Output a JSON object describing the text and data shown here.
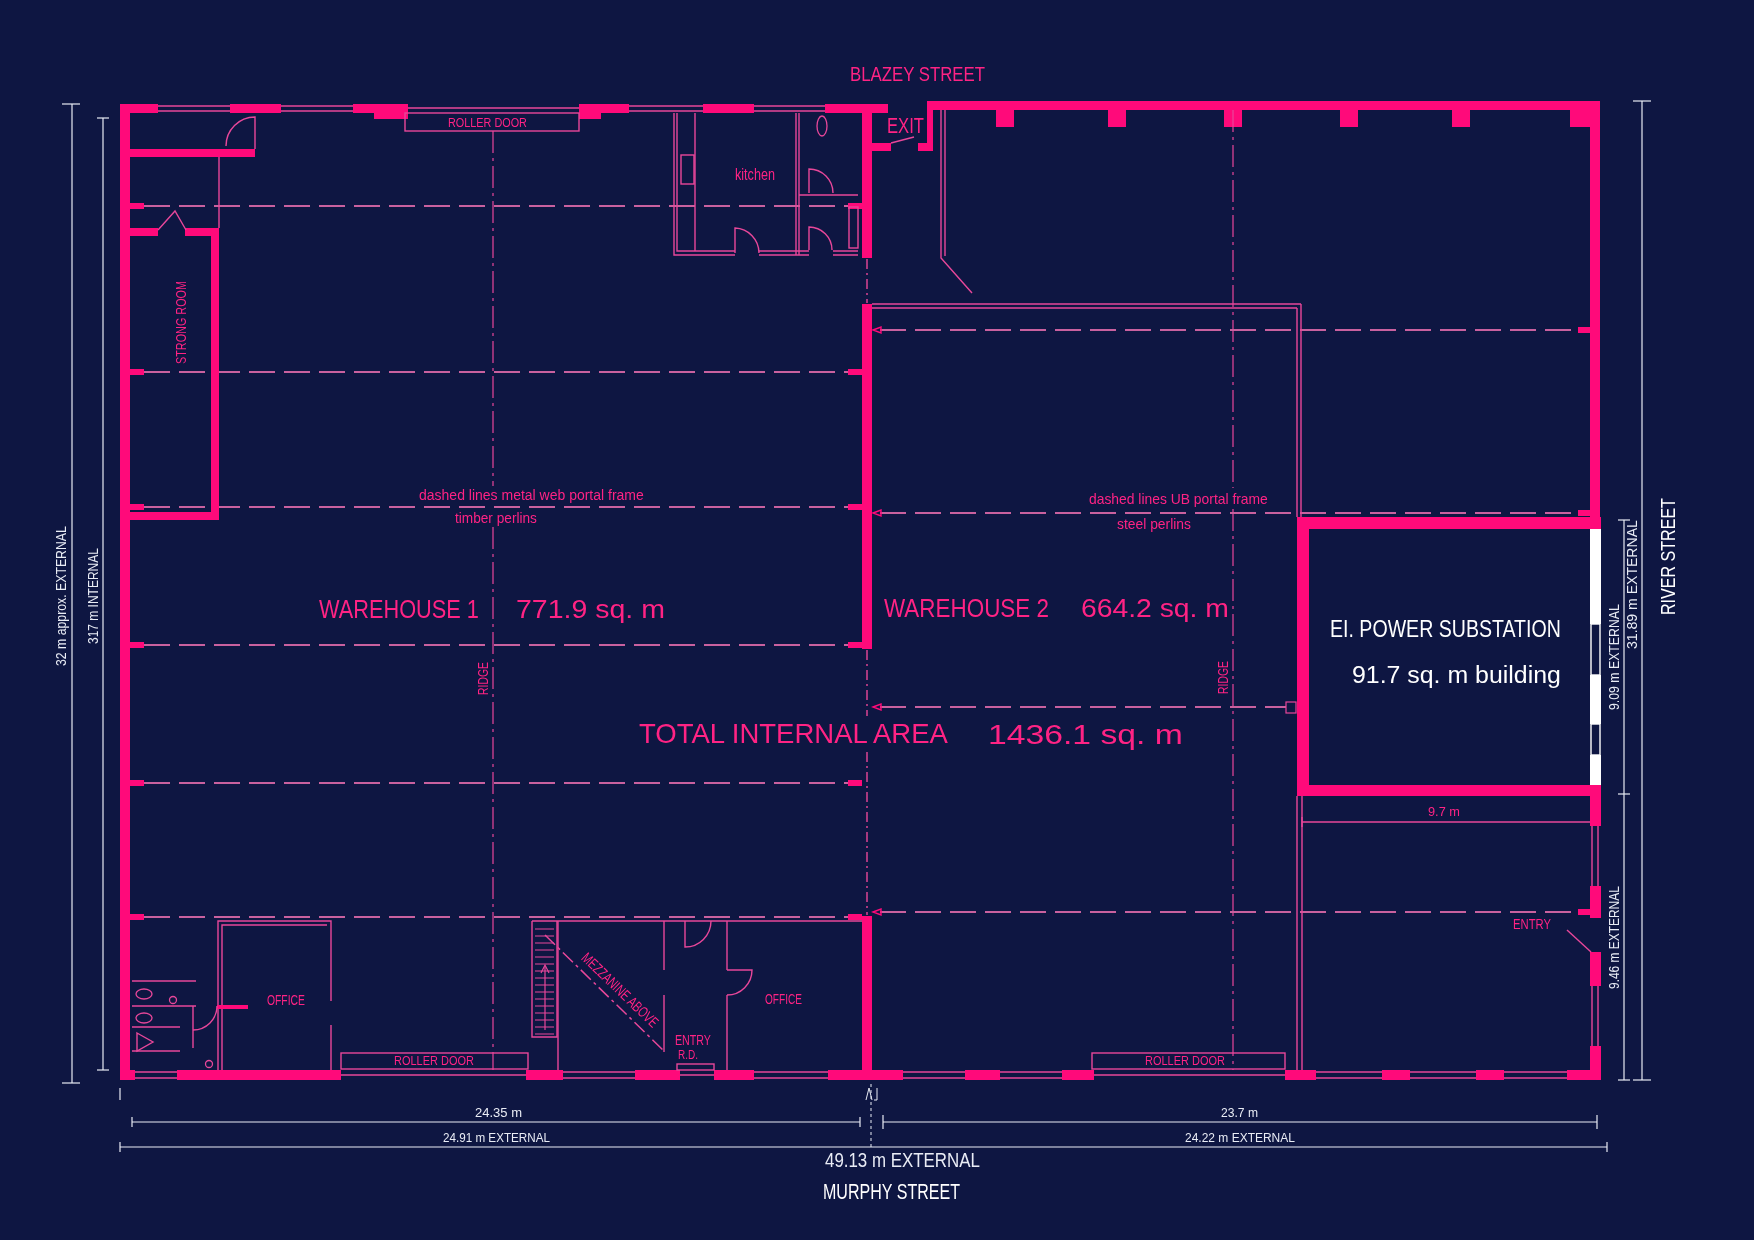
{
  "street_labels": {
    "top": "BLAZEY STREET",
    "right": "RIVER STREET",
    "bottom": "MURPHY STREET"
  },
  "warehouse_1": {
    "roller_door_top": "ROLLER DOOR",
    "kitchen": "kitchen",
    "strong_room": "STRONG ROOM",
    "frame_note": "dashed lines metal web portal frame",
    "perlin_note": "timber perlins",
    "name": "WAREHOUSE 1",
    "area": "771.9 sq. m",
    "ridge_label": "RIDGE",
    "offices": [
      "OFFICE",
      "OFFICE"
    ],
    "mezzanine_note": "MEZZANINE ABOVE",
    "entry_label": "ENTRY",
    "entry_sub_label": "R.D.",
    "roller_door_bottom": "ROLLER DOOR"
  },
  "warehouse_2": {
    "exit_label": "EXIT",
    "frame_note": "dashed lines UB portal frame",
    "perlin_note": "steel perlins",
    "name": "WAREHOUSE 2",
    "area": "664.2 sq. m",
    "ridge_label": "RIDGE",
    "bay_width": "9.7 m",
    "entry_label": "ENTRY",
    "roller_door": "ROLLER DOOR"
  },
  "total_internal_area": {
    "label": "TOTAL INTERNAL AREA",
    "area": "1436.1 sq. m"
  },
  "substation": {
    "name": "EI. POWER SUBSTATION",
    "area": "91.7 sq. m building"
  },
  "dimensions": {
    "left_external": "32 m approx. EXTERNAL",
    "left_internal": "317 m INTERNAL",
    "right_external": "31.89 m EXTERNAL",
    "right_upper_external": "9.09 m EXTERNAL",
    "right_lower_external": "9.46 m EXTERNAL",
    "bottom_left_internal": "24.35 m",
    "bottom_right_internal": "23.7 m",
    "bottom_left_external": "24.91 m EXTERNAL",
    "bottom_right_external": "24.22 m EXTERNAL",
    "bottom_total_external": "49.13 m EXTERNAL"
  }
}
